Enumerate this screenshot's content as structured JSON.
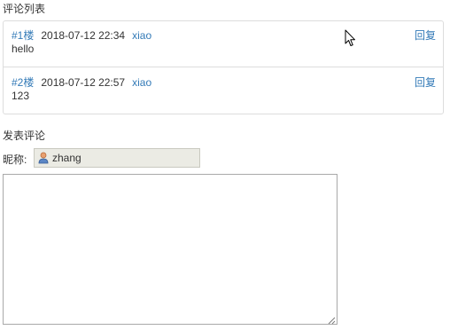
{
  "comments_section": {
    "title": "评论列表",
    "items": [
      {
        "floor": "#1楼",
        "time": "2018-07-12 22:34",
        "author": "xiao",
        "content": "hello",
        "reply_label": "回复"
      },
      {
        "floor": "#2楼",
        "time": "2018-07-12 22:57",
        "author": "xiao",
        "content": "123",
        "reply_label": "回复"
      }
    ]
  },
  "post_form": {
    "title": "发表评论",
    "nickname_label": "昵称:",
    "nickname_value": "zhang",
    "comment_text": ""
  },
  "colors": {
    "link": "#337ab7",
    "text": "#333333",
    "border": "#dddddd",
    "disabled_input_bg": "#ebebe4"
  },
  "icons": {
    "user": "user-icon",
    "cursor": "mouse-pointer-icon",
    "resize": "resize-grip-icon"
  }
}
